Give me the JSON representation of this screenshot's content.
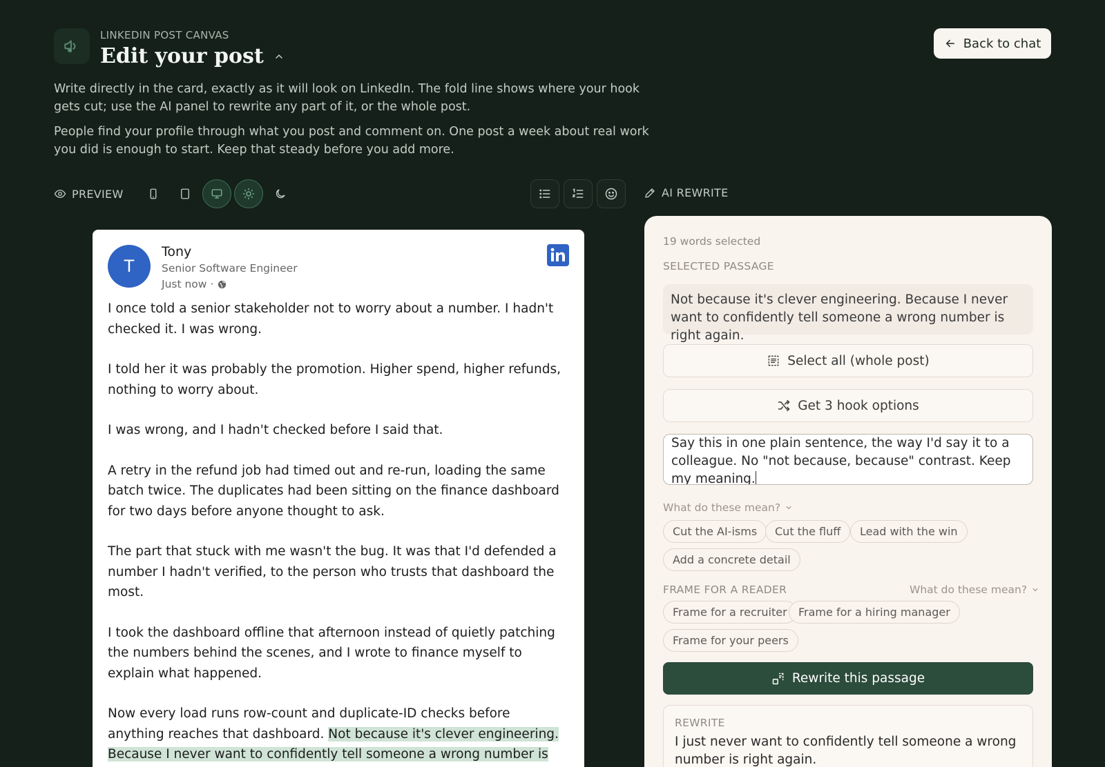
{
  "header": {
    "eyebrow": "LINKEDIN POST CANVAS",
    "title": "Edit your post",
    "description_1": "Write directly in the card, exactly as it will look on LinkedIn. The fold line shows where your hook gets cut; use the AI panel to rewrite any part of it, or the whole post.",
    "description_2": "People find your profile through what you post and comment on. One post a week about real work you did is enough to start. Keep that steady before you add more.",
    "back_label": "Back to chat",
    "icon": "megaphone-icon"
  },
  "toolbar": {
    "preview_label": "PREVIEW",
    "device_active": "desktop",
    "theme_active": "light",
    "ai_label": "AI REWRITE"
  },
  "post": {
    "author_initial": "T",
    "author_name": "Tony",
    "author_role": "Senior Software Engineer",
    "time": "Just now",
    "time_separator": "·",
    "paragraphs": [
      "I once told a senior stakeholder not to worry about a number. I hadn't checked it. I was wrong.",
      "I told her it was probably the promotion. Higher spend, higher refunds, nothing to worry about.",
      "I was wrong, and I hadn't checked before I said that.",
      "A retry in the refund job had timed out and re-run, loading the same batch twice. The duplicates had been sitting on the finance dashboard for two days before anyone thought to ask.",
      "The part that stuck with me wasn't the bug. It was that I'd defended a number I hadn't verified, to the person who trusts that dashboard the most.",
      "I took the dashboard offline that afternoon instead of quietly patching the numbers behind the scenes, and I wrote to finance myself to explain what happened."
    ],
    "last_paragraph_plain": "Now every load runs row-count and duplicate-ID checks before anything reaches that dashboard.",
    "last_paragraph_highlight": "Not because it's clever engineering. Because I never want to confidently tell someone a wrong number is right again."
  },
  "ai_panel": {
    "words_selected": "19 words selected",
    "selected_label": "SELECTED PASSAGE",
    "selected_passage": "Not because it's clever engineering. Because I never want to confidently tell someone a wrong number is right again.",
    "select_all_label": "Select all (whole post)",
    "hook_options_label": "Get 3 hook options",
    "prompt_value": "Say this in one plain sentence, the way I'd say it to a colleague. No \"not because, because\" contrast. Keep my meaning.",
    "help_label": "What do these mean?",
    "style_chips": [
      "Cut the AI-isms",
      "Cut the fluff",
      "Lead with the win",
      "Add a concrete detail"
    ],
    "frame_label": "FRAME FOR A READER",
    "frame_help_label": "What do these mean?",
    "frame_chips": [
      "Frame for a recruiter",
      "Frame for a hiring manager",
      "Frame for your peers"
    ],
    "rewrite_button": "Rewrite this passage",
    "rewrite_label": "REWRITE",
    "rewrite_text": "I just never want to confidently tell someone a wrong number is right again."
  },
  "colors": {
    "background": "#142019",
    "accent": "#2c4c3c",
    "panel": "#faf4ee",
    "linkedin_blue": "#2f63c4",
    "highlight": "#cfe3d6"
  }
}
